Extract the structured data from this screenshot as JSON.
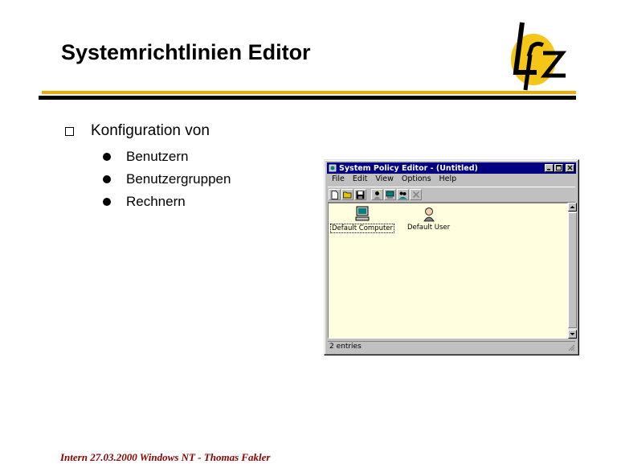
{
  "slide": {
    "title": "Systemrichtlinien Editor",
    "main_bullet": "Konfiguration von",
    "sub_bullets": [
      "Benutzern",
      "Benutzergruppen",
      "Rechnern"
    ],
    "footer": "Intern 27.03.2000 Windows NT - Thomas Fakler",
    "colors": {
      "accent_orange": "#f2a900",
      "footer_red": "#8b0000",
      "logo_yellow": "#f5c518"
    }
  },
  "window": {
    "title": "System Policy Editor - (Untitled)",
    "menu": [
      "File",
      "Edit",
      "View",
      "Options",
      "Help"
    ],
    "toolbar_icons": [
      "new-icon",
      "open-icon",
      "save-icon",
      "add-user-icon",
      "add-computer-icon",
      "add-group-icon",
      "remove-icon"
    ],
    "entries": [
      {
        "label": "Default Computer",
        "icon": "computer-icon"
      },
      {
        "label": "Default User",
        "icon": "user-icon"
      }
    ],
    "status": "2 entries",
    "colors": {
      "titlebar": "#000080",
      "content_bg": "#ffffe0"
    }
  }
}
